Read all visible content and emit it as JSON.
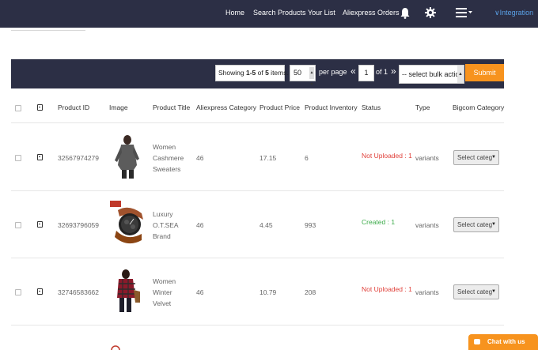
{
  "nav": {
    "links": [
      "Home",
      "Search Products",
      "Your List",
      "Aliexpress Orders"
    ],
    "integration_label": "∨Integration"
  },
  "toolbar": {
    "showing_prefix": "Showing ",
    "showing_range": "1-5",
    "showing_of": " of ",
    "showing_total": "5",
    "showing_suffix": " items.",
    "per_page_value": "50",
    "per_page_label": "per page",
    "first_symbol": "«",
    "page_value": "1",
    "of_pages": "of 1",
    "last_symbol": "»",
    "bulk_action_placeholder": "-- select bulk actio",
    "submit_label": "Submit"
  },
  "table": {
    "columns": [
      "Product ID",
      "Image",
      "Product Title",
      "Aliexpress Category",
      "Product Price",
      "Product Inventory",
      "Status",
      "Type",
      "Bigcom Category"
    ],
    "rows": [
      {
        "product_id": "32567974279",
        "title_lines": [
          "Women",
          "Cashmere",
          "Sweaters"
        ],
        "category": "46",
        "price": "17.15",
        "inventory": "6",
        "status": "Not Uploaded : 1",
        "status_kind": "not-uploaded",
        "type": "variants",
        "bigcom_category": "Select categ",
        "image": "sweater-image"
      },
      {
        "product_id": "32693796059",
        "title_lines": [
          "Luxury",
          "O.T.SEA",
          "Brand"
        ],
        "category": "46",
        "price": "4.45",
        "inventory": "993",
        "status": "Created : 1",
        "status_kind": "created",
        "type": "variants",
        "bigcom_category": "Select categ",
        "image": "watch-image"
      },
      {
        "product_id": "32746583662",
        "title_lines": [
          "Women",
          "Winter",
          "Velvet"
        ],
        "category": "46",
        "price": "10.79",
        "inventory": "208",
        "status": "Not Uploaded : 1",
        "status_kind": "not-uploaded",
        "type": "variants",
        "bigcom_category": "Select categ",
        "image": "plaid-shirt-image"
      }
    ]
  },
  "chat": {
    "label": "Chat with us"
  },
  "colors": {
    "nav_bg": "#2c2f45",
    "accent_orange": "#f7931e",
    "status_red": "#e0403a",
    "status_green": "#3cab4a",
    "link_blue": "#5aa0e6"
  }
}
